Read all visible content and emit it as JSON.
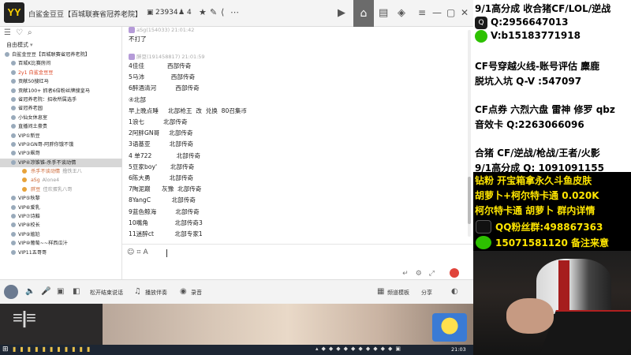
{
  "window": {
    "logo_text": "YY",
    "channel_title": "白鲨金豆豆【百城联赛省冠养老院】",
    "channel_id": "23934",
    "online_count": "4"
  },
  "left_panel": {
    "mode_label": "自由模式",
    "channels": [
      {
        "label": "白鲨金豆豆【百城联赛省冠养老院】",
        "style": "normal"
      },
      {
        "label": "百城K比赛房间",
        "style": "normal"
      },
      {
        "label": "2y1 白鲨金豆豆",
        "style": "red"
      },
      {
        "label": "贡献50搜红马",
        "style": "normal"
      },
      {
        "label": "贡献100+ 抓者6倍粉丝牌搜皇马",
        "style": "normal"
      },
      {
        "label": "省冠养老院：招收所属选手",
        "style": "normal"
      },
      {
        "label": "省冠养老园",
        "style": "normal"
      },
      {
        "label": "小仙女休息室",
        "style": "normal"
      },
      {
        "label": "直播间土豪贵",
        "style": "normal"
      },
      {
        "label": "VIP①新豆",
        "style": "normal"
      },
      {
        "label": "VIP②GN哥-阿胖你饿不饿",
        "style": "normal"
      },
      {
        "label": "VIP③飙哥",
        "style": "normal"
      },
      {
        "label": "VIP④凉锥锥-杀手不谈动情",
        "style": "sel"
      },
      {
        "label": "杀手不谈动情",
        "style": "user",
        "extra": "撸铁王八"
      },
      {
        "label": "aSg",
        "style": "user",
        "extra": "Alone4"
      },
      {
        "label": "胖豆",
        "style": "user",
        "extra": "佳欢蛋乳八哥"
      },
      {
        "label": "VIP⑤秋黎",
        "style": "normal"
      },
      {
        "label": "VIP⑥爱乳",
        "style": "normal"
      },
      {
        "label": "VIP⑦诗豁",
        "style": "normal"
      },
      {
        "label": "VIP⑧校长",
        "style": "normal"
      },
      {
        "label": "VIP⑨尴尬",
        "style": "normal"
      },
      {
        "label": "VIP⑩葡萄~~样西瓜汁",
        "style": "normal"
      },
      {
        "label": "VIP11五哥哥",
        "style": "normal"
      }
    ]
  },
  "chat": {
    "msg1_sender": "aSg(154033)  21:01:42",
    "msg1_text": "不打了",
    "msg2_sender": "胖豆(191458817)  21:01:59",
    "msg2_lines": [
      "4佳佳            西部传奇",
      "5马沛              西部传奇",
      "6醉酒清河          西部传奇",
      "④北部",
      "早上晚点睡     北部枪王  改  兑换  80召集币",
      "1浪七          北部传奇",
      "2阿胖GN哥     北部传奇",
      "3语基亚          北部传奇",
      "4 单722             北部传奇",
      "5豆家boy'       北部传奇",
      "6陈大勇          北部传奇",
      "7陶泥巅      灰豫  北部传奇",
      "8YangC           北部传奇",
      "9蓝色鲸海          北部传奇",
      "10嘴角              北部传奇3",
      "11迷醉ct           北部专家1"
    ]
  },
  "bottom_bar": {
    "mic_mode": "松开结束说话",
    "music_label": "播放伴奏",
    "record_label": "录音",
    "channel_template": "频道模板",
    "share_label": "分享"
  },
  "taskbar": {
    "time": "21:03"
  },
  "promo": {
    "lines": [
      "9/1高分成 收合猪CF/LOL/逆战",
      "Q:2956647013",
      "V:b15183771918",
      "CF号穿越火线-账号评估 麋鹿",
      "脱坑入坑  Q-V :547097",
      "CF点券 六烈六盘 雷神 修罗 qbz",
      "音效卡 Q:2263066096",
      "合猪 CF/逆战/枪战/王者/火影",
      "9/1高分成 Q:  1091091155"
    ],
    "yellow_lines": [
      "钻粉 开宝箱拿永久斗鱼皮肤",
      "胡萝卜+柯尔特卡通 0.020K",
      "柯尔特卡通 胡萝卜 群内详情",
      "QQ粉丝群:498867363",
      "15071581120 备注来意"
    ],
    "yellow_color": "#ffe600"
  }
}
